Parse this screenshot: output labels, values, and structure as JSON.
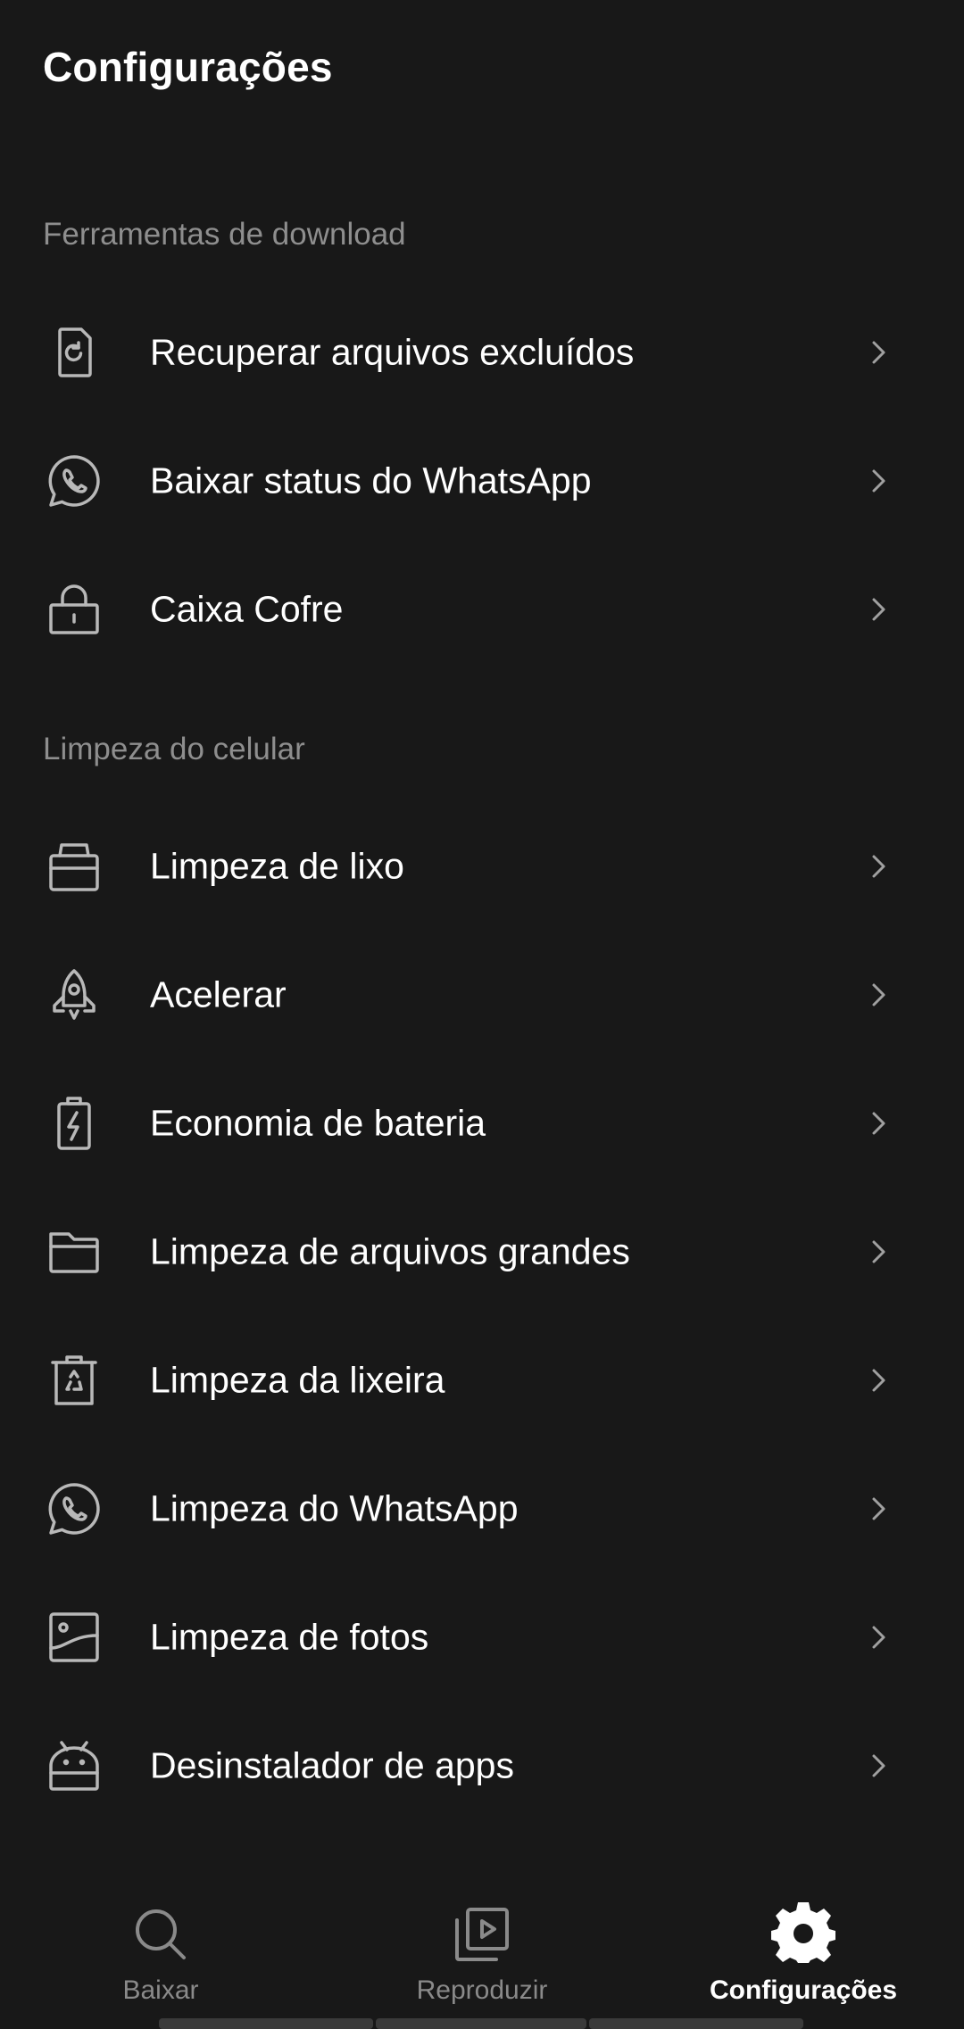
{
  "page": {
    "title": "Configurações"
  },
  "sections": {
    "download_tools": {
      "label": "Ferramentas de download",
      "items": [
        {
          "label": "Recuperar arquivos excluídos",
          "icon": "file-restore-icon"
        },
        {
          "label": "Baixar status do WhatsApp",
          "icon": "whatsapp-icon"
        },
        {
          "label": "Caixa Cofre",
          "icon": "lock-icon"
        }
      ]
    },
    "phone_cleaning": {
      "label": "Limpeza do celular",
      "items": [
        {
          "label": "Limpeza de lixo",
          "icon": "junk-bin-icon"
        },
        {
          "label": "Acelerar",
          "icon": "rocket-icon"
        },
        {
          "label": "Economia de bateria",
          "icon": "battery-charge-icon"
        },
        {
          "label": "Limpeza de arquivos grandes",
          "icon": "folder-icon"
        },
        {
          "label": "Limpeza da lixeira",
          "icon": "recycle-bin-icon"
        },
        {
          "label": "Limpeza do WhatsApp",
          "icon": "whatsapp-icon"
        },
        {
          "label": "Limpeza de fotos",
          "icon": "photo-icon"
        },
        {
          "label": "Desinstalador de apps",
          "icon": "android-icon"
        }
      ]
    }
  },
  "bottom_nav": {
    "tabs": [
      {
        "label": "Baixar",
        "icon": "search-icon",
        "active": false
      },
      {
        "label": "Reproduzir",
        "icon": "play-library-icon",
        "active": false
      },
      {
        "label": "Configurações",
        "icon": "gear-icon",
        "active": true
      }
    ]
  },
  "colors": {
    "background": "#181818",
    "text_primary": "#ffffff",
    "text_secondary": "#8e8e8e",
    "icon": "#b8b8b8"
  }
}
